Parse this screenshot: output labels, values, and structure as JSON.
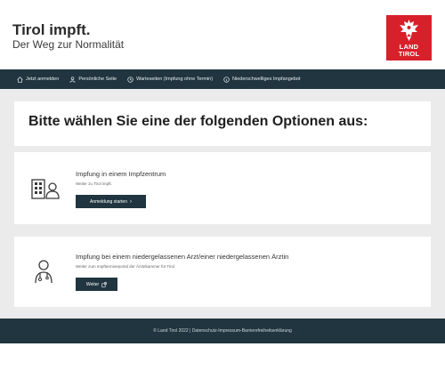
{
  "header": {
    "title": "Tirol impft.",
    "subtitle": "Der Weg zur Normalität",
    "logo_line1": "LAND",
    "logo_line2": "TIROL"
  },
  "nav": {
    "items": [
      {
        "label": "Jetzt anmelden",
        "icon": "home-icon"
      },
      {
        "label": "Persönliche Seite",
        "icon": "user-icon"
      },
      {
        "label": "Warteseiten (Impfung ohne Termin)",
        "icon": "clock-icon"
      },
      {
        "label": "Niederschwelliges Impfangebot",
        "icon": "info-icon"
      }
    ]
  },
  "main": {
    "heading": "Bitte wählen Sie eine der folgenden Optionen aus:",
    "options": [
      {
        "title": "Impfung in einem Impfzentrum",
        "subtitle": "Weiter zu Tirol impft.",
        "button": "Anmeldung starten",
        "button_icon": "chevron-right-icon",
        "icon": "building-person-icon"
      },
      {
        "title": "Impfung bei einem niedergelassenen Arzt/einer niedergelassenen Ärztin",
        "subtitle": "Weiter zum Impftermineportal der Ärztekammer für Tirol",
        "button": "Weiter",
        "button_icon": "external-link-icon",
        "icon": "doctor-icon"
      }
    ]
  },
  "footer": {
    "copyright": "© Land Tirol 2022",
    "separator": "|",
    "link1": "Datenschutz",
    "dash1": " - ",
    "link2": "Impressum",
    "dash2": " - ",
    "link3": "Barrierefreiheitserklärung"
  },
  "colors": {
    "navy": "#20353f",
    "brand_red": "#d8202a",
    "background": "#ebebeb"
  }
}
